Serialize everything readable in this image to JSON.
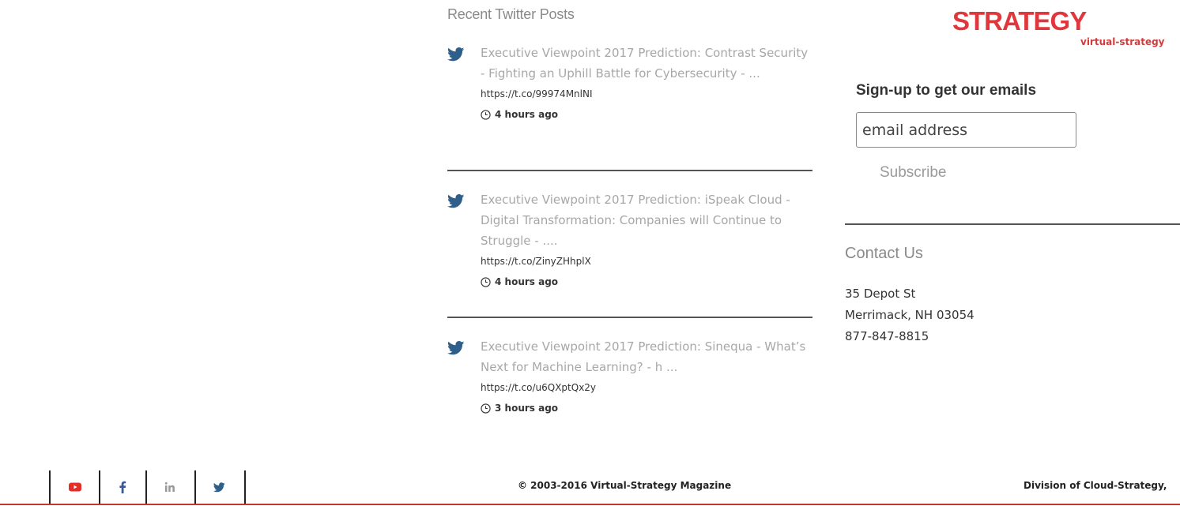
{
  "twitter": {
    "heading": "Recent Twitter Posts",
    "icon": "twitter-bird-icon",
    "icon_color": "#2e5f8a",
    "posts": [
      {
        "text": "Executive Viewpoint 2017 Prediction: Contrast Security - Fighting an Uphill Battle for Cybersecurity - ...",
        "link": "https://t.co/99974MnlNI",
        "time": "4 hours ago"
      },
      {
        "text": "Executive Viewpoint 2017 Prediction: iSpeak Cloud - Digital Transformation: Companies will Continue to Struggle - ....",
        "link": "https://t.co/ZinyZHhplX",
        "time": "4 hours ago"
      },
      {
        "text": "Executive Viewpoint 2017 Prediction: Sinequa - What’s Next for Machine Learning? - h ...",
        "link": "https://t.co/u6QXptQx2y",
        "time": "3 hours ago"
      }
    ]
  },
  "logo": {
    "word": "STRATEGY",
    "url_text": "virtual-strategy",
    "color": "#e0373d"
  },
  "signup": {
    "title": "Sign-up to get our emails",
    "placeholder": "email address",
    "button_label": "Subscribe"
  },
  "contact": {
    "title": "Contact Us",
    "street": "35 Depot St",
    "city": "Merrimack, NH 03054",
    "phone": "877-847-8815"
  },
  "footer": {
    "social": [
      {
        "icon": "youtube-icon",
        "color": "#e52d27"
      },
      {
        "icon": "facebook-icon",
        "color": "#3b5998"
      },
      {
        "icon": "linkedin-icon",
        "color": "#999999"
      },
      {
        "icon": "twitter-icon",
        "color": "#2e5f8a"
      }
    ],
    "copyright": "© 2003-2016 Virtual-Strategy Magazine",
    "division": "Division of Cloud-Strategy,",
    "rule_color": "#c0392b"
  }
}
